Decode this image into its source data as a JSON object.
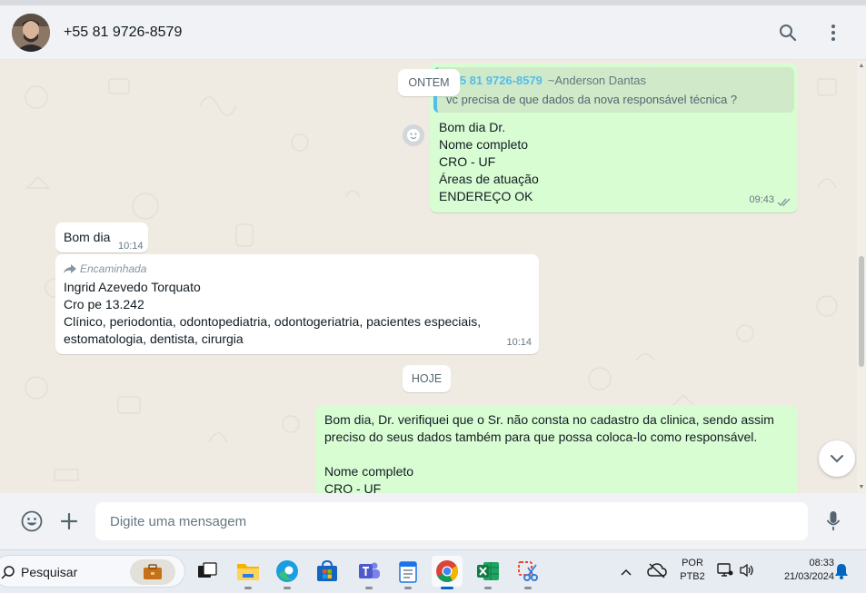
{
  "header": {
    "contact_name": "+55 81 9726-8579",
    "avatar_icon": "contact-photo",
    "search_icon": "search-icon",
    "menu_icon": "kebab-menu-icon"
  },
  "chat": {
    "date_yesterday": "ONTEM",
    "date_today": "HOJE",
    "messages": [
      {
        "direction": "outgoing",
        "quote": {
          "number": "+55 81 9726-8579",
          "name": "~Anderson Dantas",
          "text": "vc precisa de que dados da nova responsável técnica ?"
        },
        "lines": [
          "Bom dia Dr.",
          "Nome completo",
          "CRO - UF",
          "Áreas de atuação",
          "ENDEREÇO OK"
        ],
        "time": "09:43",
        "status": "read"
      },
      {
        "direction": "incoming",
        "lines": [
          "Bom dia"
        ],
        "time": "10:14"
      },
      {
        "direction": "incoming",
        "forwarded_label": "Encaminhada",
        "lines": [
          "Ingrid Azevedo Torquato",
          "Cro pe 13.242",
          "Clínico, periodontia, odontopediatria, odontogeriatria, pacientes especiais,",
          "estomatologia, dentista, cirurgia"
        ],
        "time": "10:14"
      },
      {
        "direction": "outgoing",
        "lines": [
          "Bom dia, Dr. verifiquei que o Sr. não consta no cadastro da clinica, sendo assim",
          "preciso do seus dados também para que possa coloca-lo como responsável.",
          "",
          "Nome completo",
          "CRO - UF"
        ]
      }
    ]
  },
  "composer": {
    "placeholder": "Digite uma mensagem",
    "emoji_icon": "emoji-icon",
    "attach_icon": "plus-icon",
    "mic_icon": "microphone-icon"
  },
  "taskbar": {
    "search_label": "Pesquisar",
    "apps": [
      "task-view",
      "file-explorer",
      "edge",
      "microsoft-store",
      "teams",
      "notepad",
      "chrome",
      "excel",
      "snipping-tool"
    ],
    "language_line1": "POR",
    "language_line2": "PTB2",
    "clock_time": "08:33",
    "clock_date": "21/03/2024"
  }
}
